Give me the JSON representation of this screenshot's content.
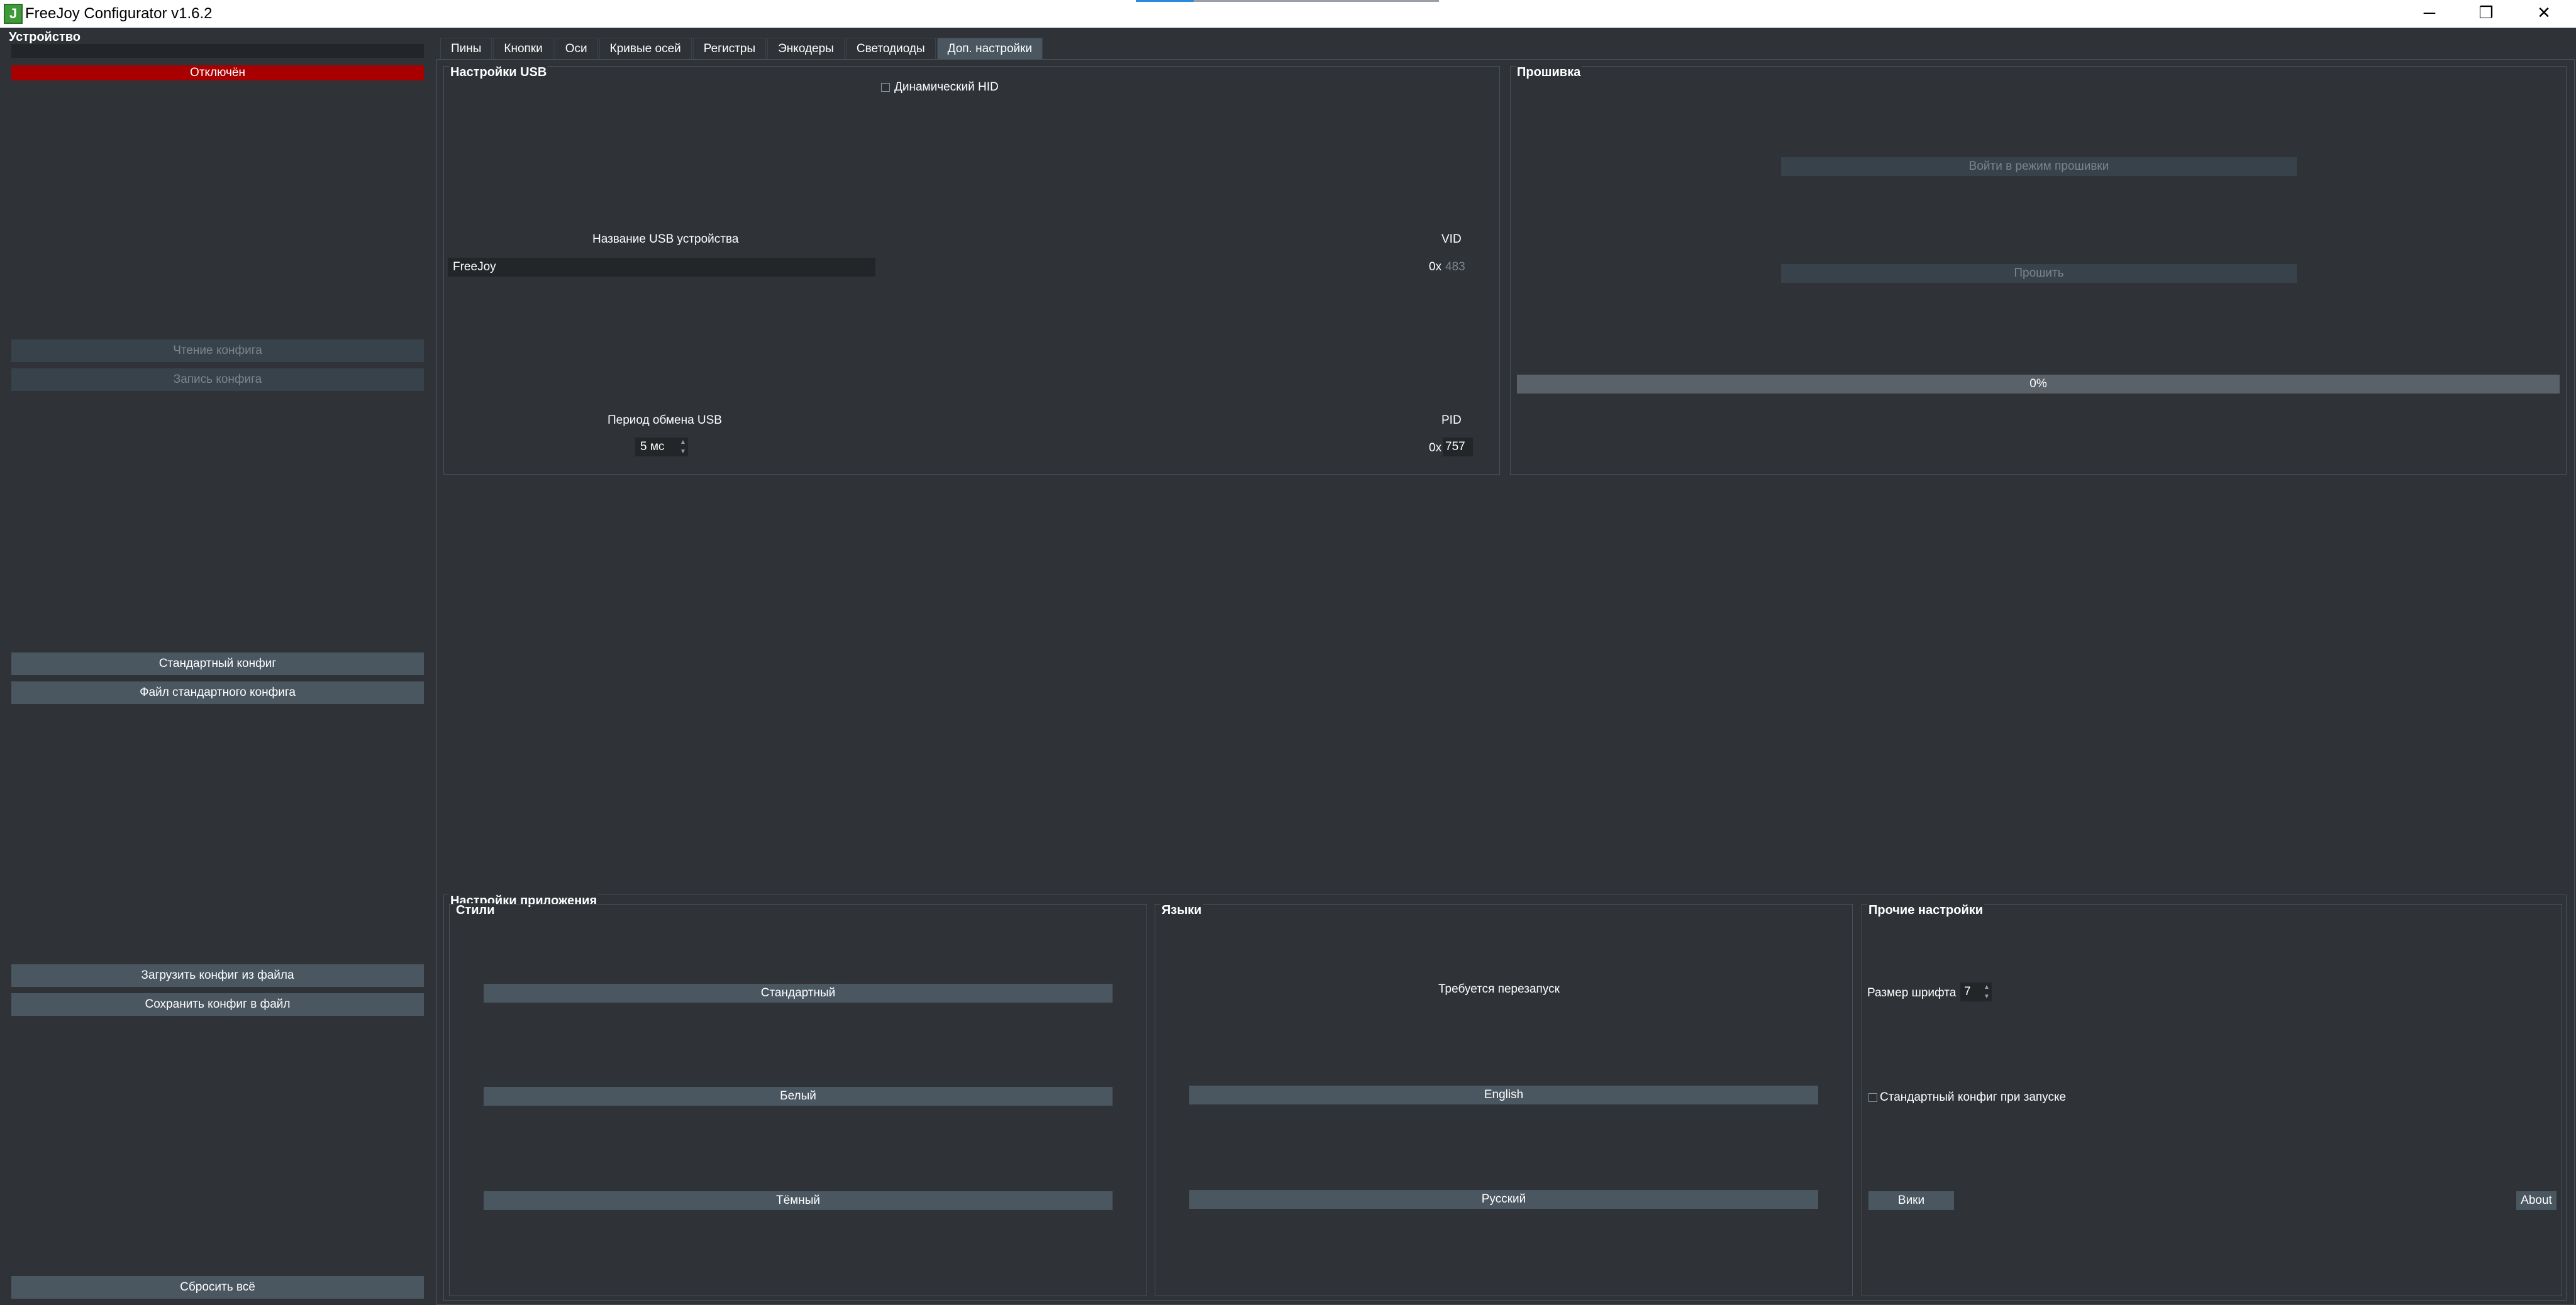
{
  "window": {
    "title": "FreeJoy Configurator v1.6.2",
    "icon_name": "freejoy-app-icon",
    "controls": {
      "minimize": "─",
      "maximize": "❐",
      "close": "✕"
    }
  },
  "left_panel": {
    "title": "Устройство",
    "status": "Отключён",
    "read_config": "Чтение конфига",
    "write_config": "Запись конфига",
    "default_config": "Стандартный конфиг",
    "default_config_file": "Файл стандартного конфига",
    "load_from_file": "Загрузить конфиг из файла",
    "save_to_file": "Сохранить конфиг в файл",
    "reset_all": "Сбросить всё"
  },
  "tabs": [
    {
      "label": "Пины"
    },
    {
      "label": "Кнопки"
    },
    {
      "label": "Оси"
    },
    {
      "label": "Кривые осей"
    },
    {
      "label": "Регистры"
    },
    {
      "label": "Энкодеры"
    },
    {
      "label": "Светодиоды"
    },
    {
      "label": "Доп. настройки",
      "active": true
    }
  ],
  "usb_settings": {
    "title": "Настройки USB",
    "dynamic_hid": "Динамический HID",
    "device_name_label": "Название USB устройства",
    "device_name_value": "FreeJoy",
    "vid_label": "VID",
    "vid_prefix": "0x",
    "vid_value": "483",
    "period_label": "Период обмена USB",
    "period_value": "5 мс",
    "pid_label": "PID",
    "pid_prefix": "0x",
    "pid_value": "757"
  },
  "firmware": {
    "title": "Прошивка",
    "enter_flash_mode": "Войти в режим прошивки",
    "flash": "Прошить",
    "progress_text": "0%",
    "progress_value": 0
  },
  "app_settings": {
    "title": "Настройки приложения",
    "styles": {
      "title": "Стили",
      "standard": "Стандартный",
      "white": "Белый",
      "dark": "Тёмный"
    },
    "languages": {
      "title": "Языки",
      "restart_note": "Требуется перезапуск",
      "english": "English",
      "russian": "Русский"
    },
    "other": {
      "title": "Прочие настройки",
      "font_size_label": "Размер шрифта",
      "font_size_value": "7",
      "default_on_start": "Стандартный конфиг при запуске",
      "wiki": "Вики",
      "about": "About"
    }
  },
  "colors": {
    "background": "#2f3338",
    "button": "#4a5660",
    "status_error": "#a80000"
  }
}
